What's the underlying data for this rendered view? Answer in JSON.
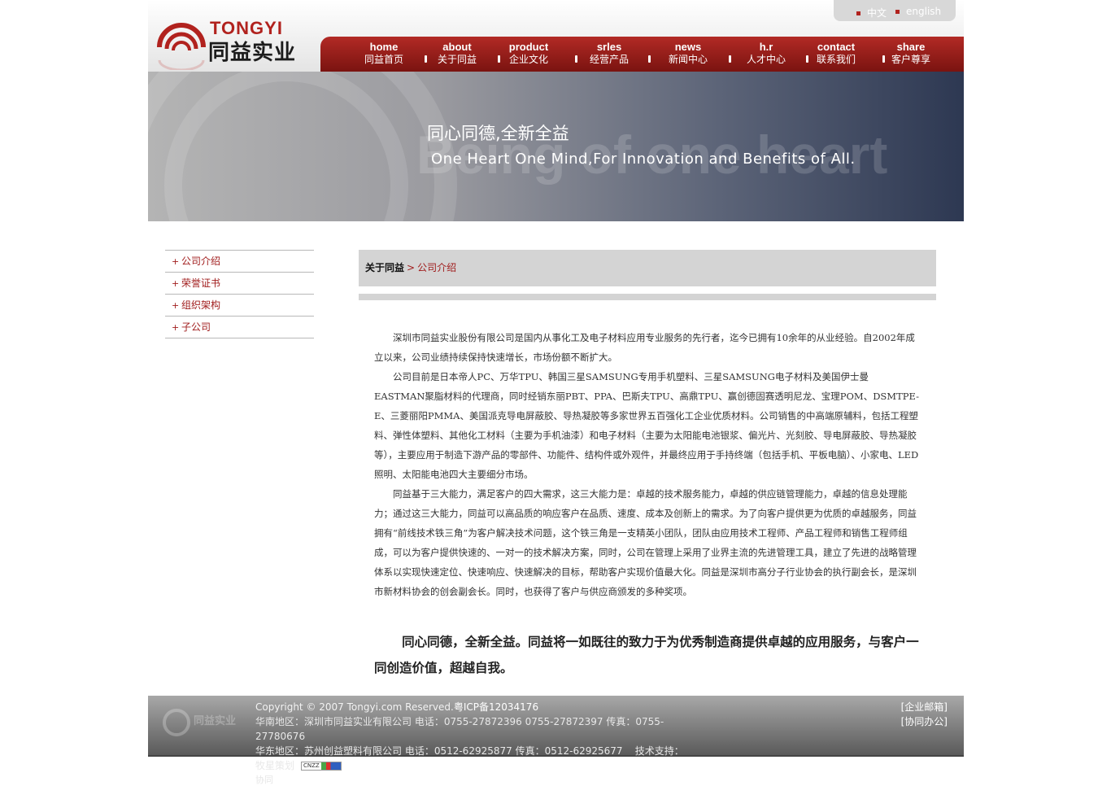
{
  "colors": {
    "brand_red": "#b1221e",
    "nav_dark_red": "#7a1310",
    "crumb_bg": "#d4d4d4",
    "link_red": "#a01c1c"
  },
  "logo": {
    "en": "TONGYI",
    "cn": "同益实业"
  },
  "lang": {
    "cn": "中文",
    "en": "english"
  },
  "nav": [
    {
      "en": "home",
      "cn": "同益首页"
    },
    {
      "en": "about",
      "cn": "关于同益"
    },
    {
      "en": "product",
      "cn": "企业文化"
    },
    {
      "en": "srles",
      "cn": "经营产品"
    },
    {
      "en": "news",
      "cn": "新闻中心"
    },
    {
      "en": "h.r",
      "cn": "人才中心"
    },
    {
      "en": "contact",
      "cn": "联系我们"
    },
    {
      "en": "share",
      "cn": "客户尊享"
    }
  ],
  "banner": {
    "slogan_cn": "同心同德,全新全益",
    "slogan_en": "One Heart One Mind,For Innovation and Benefits of All.",
    "watermark": "Being of one heart"
  },
  "sidebar": {
    "items": [
      "公司介绍",
      "荣誉证书",
      "组织架构",
      "子公司"
    ]
  },
  "breadcrumb": {
    "parent": "关于同益",
    "separator": ">",
    "current": "公司介绍"
  },
  "content": {
    "p1": "深圳市同益实业股份有限公司是国内从事化工及电子材料应用专业服务的先行者，迄今已拥有10余年的从业经验。自2002年成立以来，公司业绩持续保持快速增长，市场份额不断扩大。",
    "p2": "公司目前是日本帝人PC、万华TPU、韩国三星SAMSUNG专用手机塑料、三星SAMSUNG电子材料及美国伊士曼EASTMAN聚脂材料的代理商，同时经销东丽PBT、PPA、巴斯夫TPU、高鼎TPU、赢创德固赛透明尼龙、宝理POM、DSMTPE-E、三菱丽阳PMMA、美国派克导电屏蔽胶、导热凝胶等多家世界五百强化工企业优质材料。公司销售的中高端原辅料，包括工程塑料、弹性体塑料、其他化工材料（主要为手机油漆）和电子材料（主要为太阳能电池银浆、偏光片、光刻胶、导电屏蔽胶、导热凝胶等），主要应用于制造下游产品的零部件、功能件、结构件或外观件，并最终应用于手持终端（包括手机、平板电脑）、小家电、LED照明、太阳能电池四大主要细分市场。",
    "p3": "同益基于三大能力，满足客户的四大需求，这三大能力是：卓越的技术服务能力，卓越的供应链管理能力，卓越的信息处理能力；通过这三大能力，同益可以高品质的响应客户在品质、速度、成本及创新上的需求。为了向客户提供更为优质的卓越服务，同益拥有“前线技术铁三角”为客户解决技术问题，这个铁三角是一支精英小团队，团队由应用技术工程师、产品工程师和销售工程师组成，可以为客户提供快速的、一对一的技术解决方案，同时，公司在管理上采用了业界主流的先进管理工具，建立了先进的战略管理体系以实现快速定位、快速响应、快速解决的目标，帮助客户实现价值最大化。同益是深圳市高分子行业协会的执行副会长，是深圳市新材料协会的创会副会长。同时，也获得了客户与供应商颁发的多种奖项。",
    "motto": "同心同德，全新全益。同益将一如既往的致力于为优秀制造商提供卓越的应用服务，与客户一同创造价值，超越自我。"
  },
  "footer": {
    "copyright": "Copyright © 2007 Tongyi.com Reserved.",
    "icp": "粤ICP备12034176",
    "line2": "华南地区：深圳市同益实业有限公司 电话：0755-27872396 0755-27872397 传真：0755-27780676",
    "line3": "华东地区：苏州创益塑料有限公司 电话：0512-62925877 传真：0512-62925677",
    "support": "技术支持：牧星策划",
    "cnzz": "CNZZ",
    "link_mail": "[企业邮箱]",
    "link_office": "[协同办公]",
    "extra": "协同"
  }
}
